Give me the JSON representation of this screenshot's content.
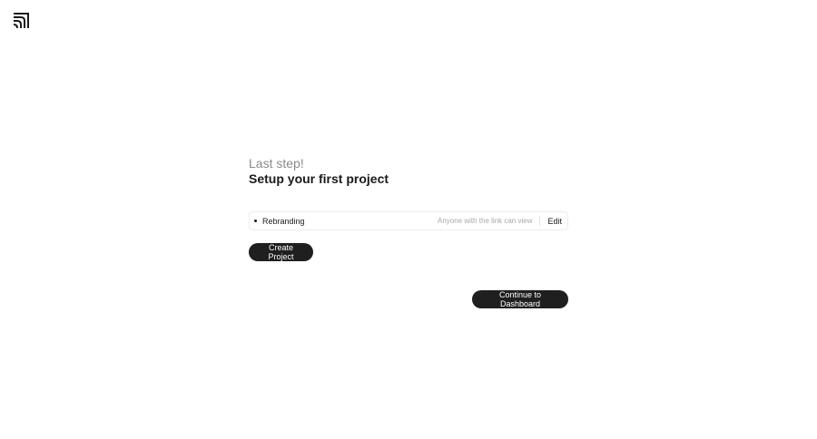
{
  "logo": {
    "icon": "brand-logo-icon"
  },
  "onboarding": {
    "subtitle": "Last step!",
    "title": "Setup your first project"
  },
  "project": {
    "name": "Rebranding",
    "visibility": "Anyone with the link can view",
    "edit_label": "Edit"
  },
  "actions": {
    "create_label": "Create Project",
    "continue_label": "Continue to Dashboard"
  },
  "colors": {
    "primary_button": "#1f1f1f",
    "muted_text": "#8a8a8a"
  }
}
